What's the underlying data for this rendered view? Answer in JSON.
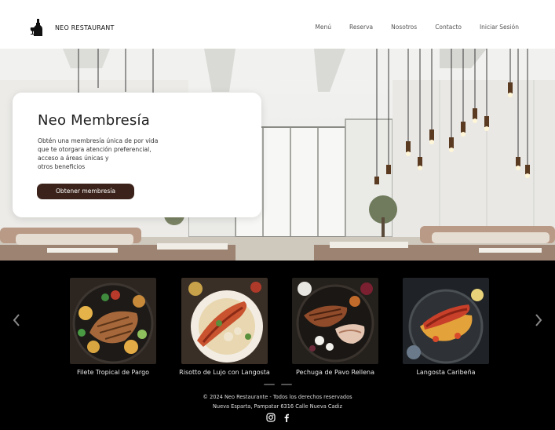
{
  "header": {
    "brand": "NEO RESTAURANT",
    "logo_icon": "wine-bottle-glass-icon",
    "nav": [
      {
        "label": "Menú"
      },
      {
        "label": "Reserva"
      },
      {
        "label": "Nosotros"
      },
      {
        "label": "Contacto"
      },
      {
        "label": "Iniciar Sesión"
      }
    ]
  },
  "hero": {
    "image": "restaurant-interior-photo",
    "card": {
      "title": "Neo Membresía",
      "lines": [
        "Obtén una membresía única de por vida",
        "que te otorgara atención preferencial,",
        "acceso a áreas únicas y",
        "otros beneficios"
      ],
      "button": "Obtener membresía"
    }
  },
  "carousel": {
    "prev_icon": "chevron-left-icon",
    "next_icon": "chevron-right-icon",
    "dishes": [
      {
        "name": "Filete Tropical de Pargo"
      },
      {
        "name": "Risotto de Lujo con Langosta"
      },
      {
        "name": "Pechuga de Pavo Rellena"
      },
      {
        "name": "Langosta Caribeña"
      }
    ],
    "indicator_count": 2
  },
  "footer": {
    "copyright": "© 2024 Neo Restaurante - Todos los derechos reservados",
    "address": "Nueva Esparta, Pampatar 6316 Calle Nueva Cadiz",
    "socials": [
      "instagram-icon",
      "facebook-icon"
    ]
  },
  "colors": {
    "button": "#3b231b",
    "dark_bg": "#000000",
    "card_bg": "#ffffff"
  }
}
